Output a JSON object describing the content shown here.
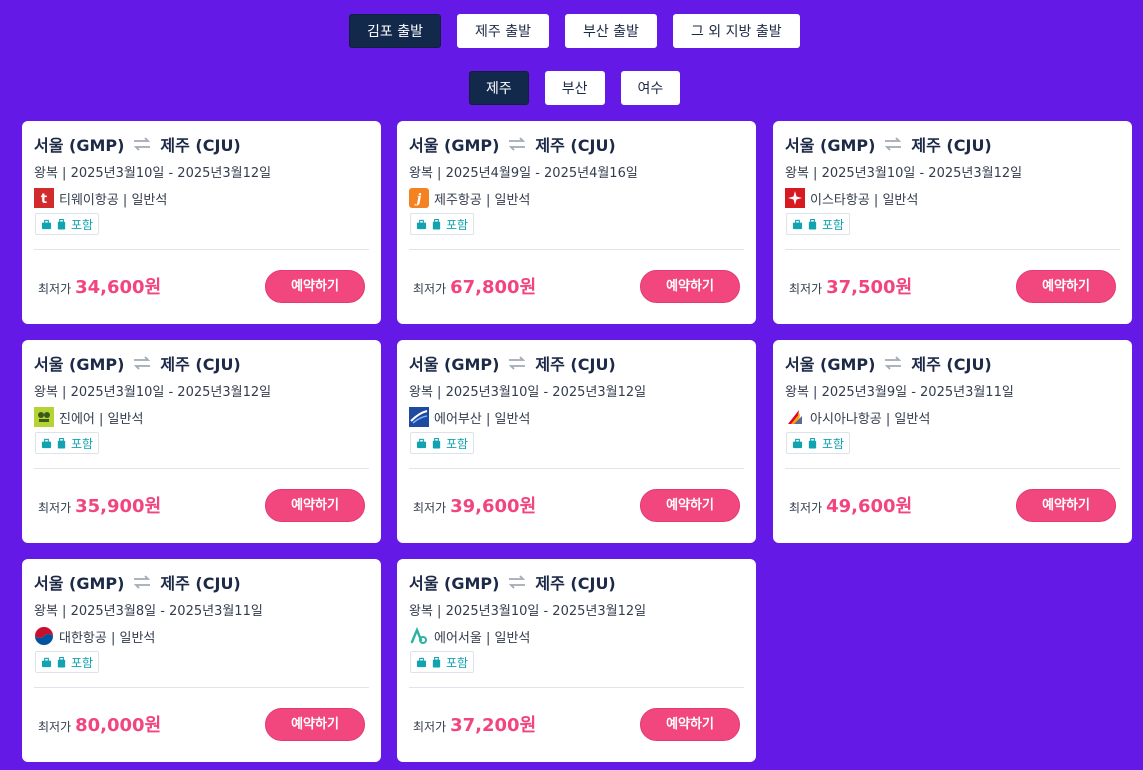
{
  "origin_tabs": [
    "김포 출발",
    "제주 출발",
    "부산 출발",
    "그 외 지방 출발"
  ],
  "destination_tabs": [
    "제주",
    "부산",
    "여수"
  ],
  "accent_color": "#6419e6",
  "cards": [
    {
      "from": "서울 (GMP)",
      "to": "제주 (CJU)",
      "dates": "왕복 | 2025년3월10일 - 2025년3월12일",
      "airline": "티웨이항공 | 일반석",
      "logo": "tway-logo",
      "baggage": "포함",
      "price_label": "최저가",
      "price": "34,600원",
      "button": "예약하기"
    },
    {
      "from": "서울 (GMP)",
      "to": "제주 (CJU)",
      "dates": "왕복 | 2025년4월9일 - 2025년4월16일",
      "airline": "제주항공 | 일반석",
      "logo": "jejuair-logo",
      "baggage": "포함",
      "price_label": "최저가",
      "price": "67,800원",
      "button": "예약하기"
    },
    {
      "from": "서울 (GMP)",
      "to": "제주 (CJU)",
      "dates": "왕복 | 2025년3월10일 - 2025년3월12일",
      "airline": "이스타항공 | 일반석",
      "logo": "eastar-logo",
      "baggage": "포함",
      "price_label": "최저가",
      "price": "37,500원",
      "button": "예약하기"
    },
    {
      "from": "서울 (GMP)",
      "to": "제주 (CJU)",
      "dates": "왕복 | 2025년3월10일 - 2025년3월12일",
      "airline": "진에어 | 일반석",
      "logo": "jinair-logo",
      "baggage": "포함",
      "price_label": "최저가",
      "price": "35,900원",
      "button": "예약하기"
    },
    {
      "from": "서울 (GMP)",
      "to": "제주 (CJU)",
      "dates": "왕복 | 2025년3월10일 - 2025년3월12일",
      "airline": "에어부산 | 일반석",
      "logo": "airbusan-logo",
      "baggage": "포함",
      "price_label": "최저가",
      "price": "39,600원",
      "button": "예약하기"
    },
    {
      "from": "서울 (GMP)",
      "to": "제주 (CJU)",
      "dates": "왕복 | 2025년3월9일 - 2025년3월11일",
      "airline": "아시아나항공 | 일반석",
      "logo": "asiana-logo",
      "baggage": "포함",
      "price_label": "최저가",
      "price": "49,600원",
      "button": "예약하기"
    },
    {
      "from": "서울 (GMP)",
      "to": "제주 (CJU)",
      "dates": "왕복 | 2025년3월8일 - 2025년3월11일",
      "airline": "대한항공 | 일반석",
      "logo": "koreanair-logo",
      "baggage": "포함",
      "price_label": "최저가",
      "price": "80,000원",
      "button": "예약하기"
    },
    {
      "from": "서울 (GMP)",
      "to": "제주 (CJU)",
      "dates": "왕복 | 2025년3월10일 - 2025년3월12일",
      "airline": "에어서울 | 일반석",
      "logo": "airseoul-logo",
      "baggage": "포함",
      "price_label": "최저가",
      "price": "37,200원",
      "button": "예약하기"
    }
  ]
}
